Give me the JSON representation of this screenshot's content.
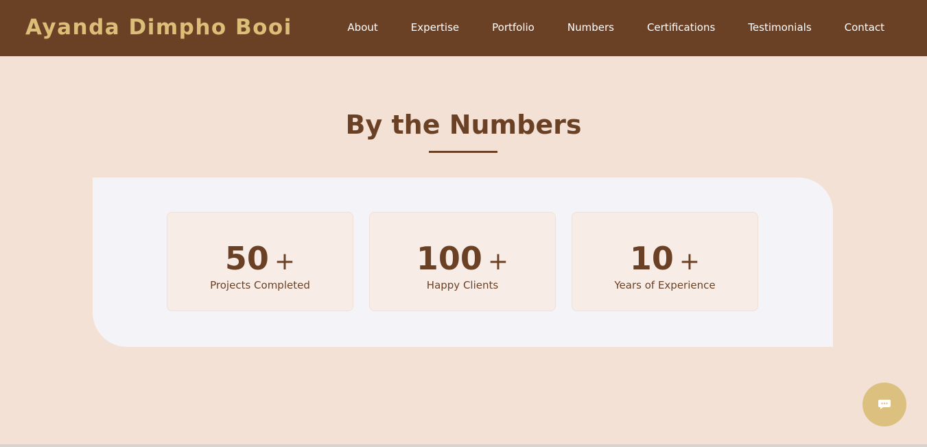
{
  "header": {
    "brand": "Ayanda Dimpho Booi",
    "nav": [
      "About",
      "Expertise",
      "Portfolio",
      "Numbers",
      "Certifications",
      "Testimonials",
      "Contact"
    ]
  },
  "numbers_section": {
    "title": "By the Numbers",
    "stats": [
      {
        "value": "50",
        "suffix": "+",
        "label": "Projects Completed"
      },
      {
        "value": "100",
        "suffix": "+",
        "label": "Happy Clients"
      },
      {
        "value": "10",
        "suffix": "+",
        "label": "Years of Experience"
      }
    ]
  },
  "chat": {
    "icon": "chat-bubble-icon"
  },
  "colors": {
    "nav_background": "#6b4126",
    "brand_gold": "#dcbe78",
    "page_background": "#f3e1d6",
    "panel_background": "#f4f3f8",
    "card_background": "#f8ede6",
    "text_brown": "#6b4126",
    "chat_button": "#dcc080"
  }
}
